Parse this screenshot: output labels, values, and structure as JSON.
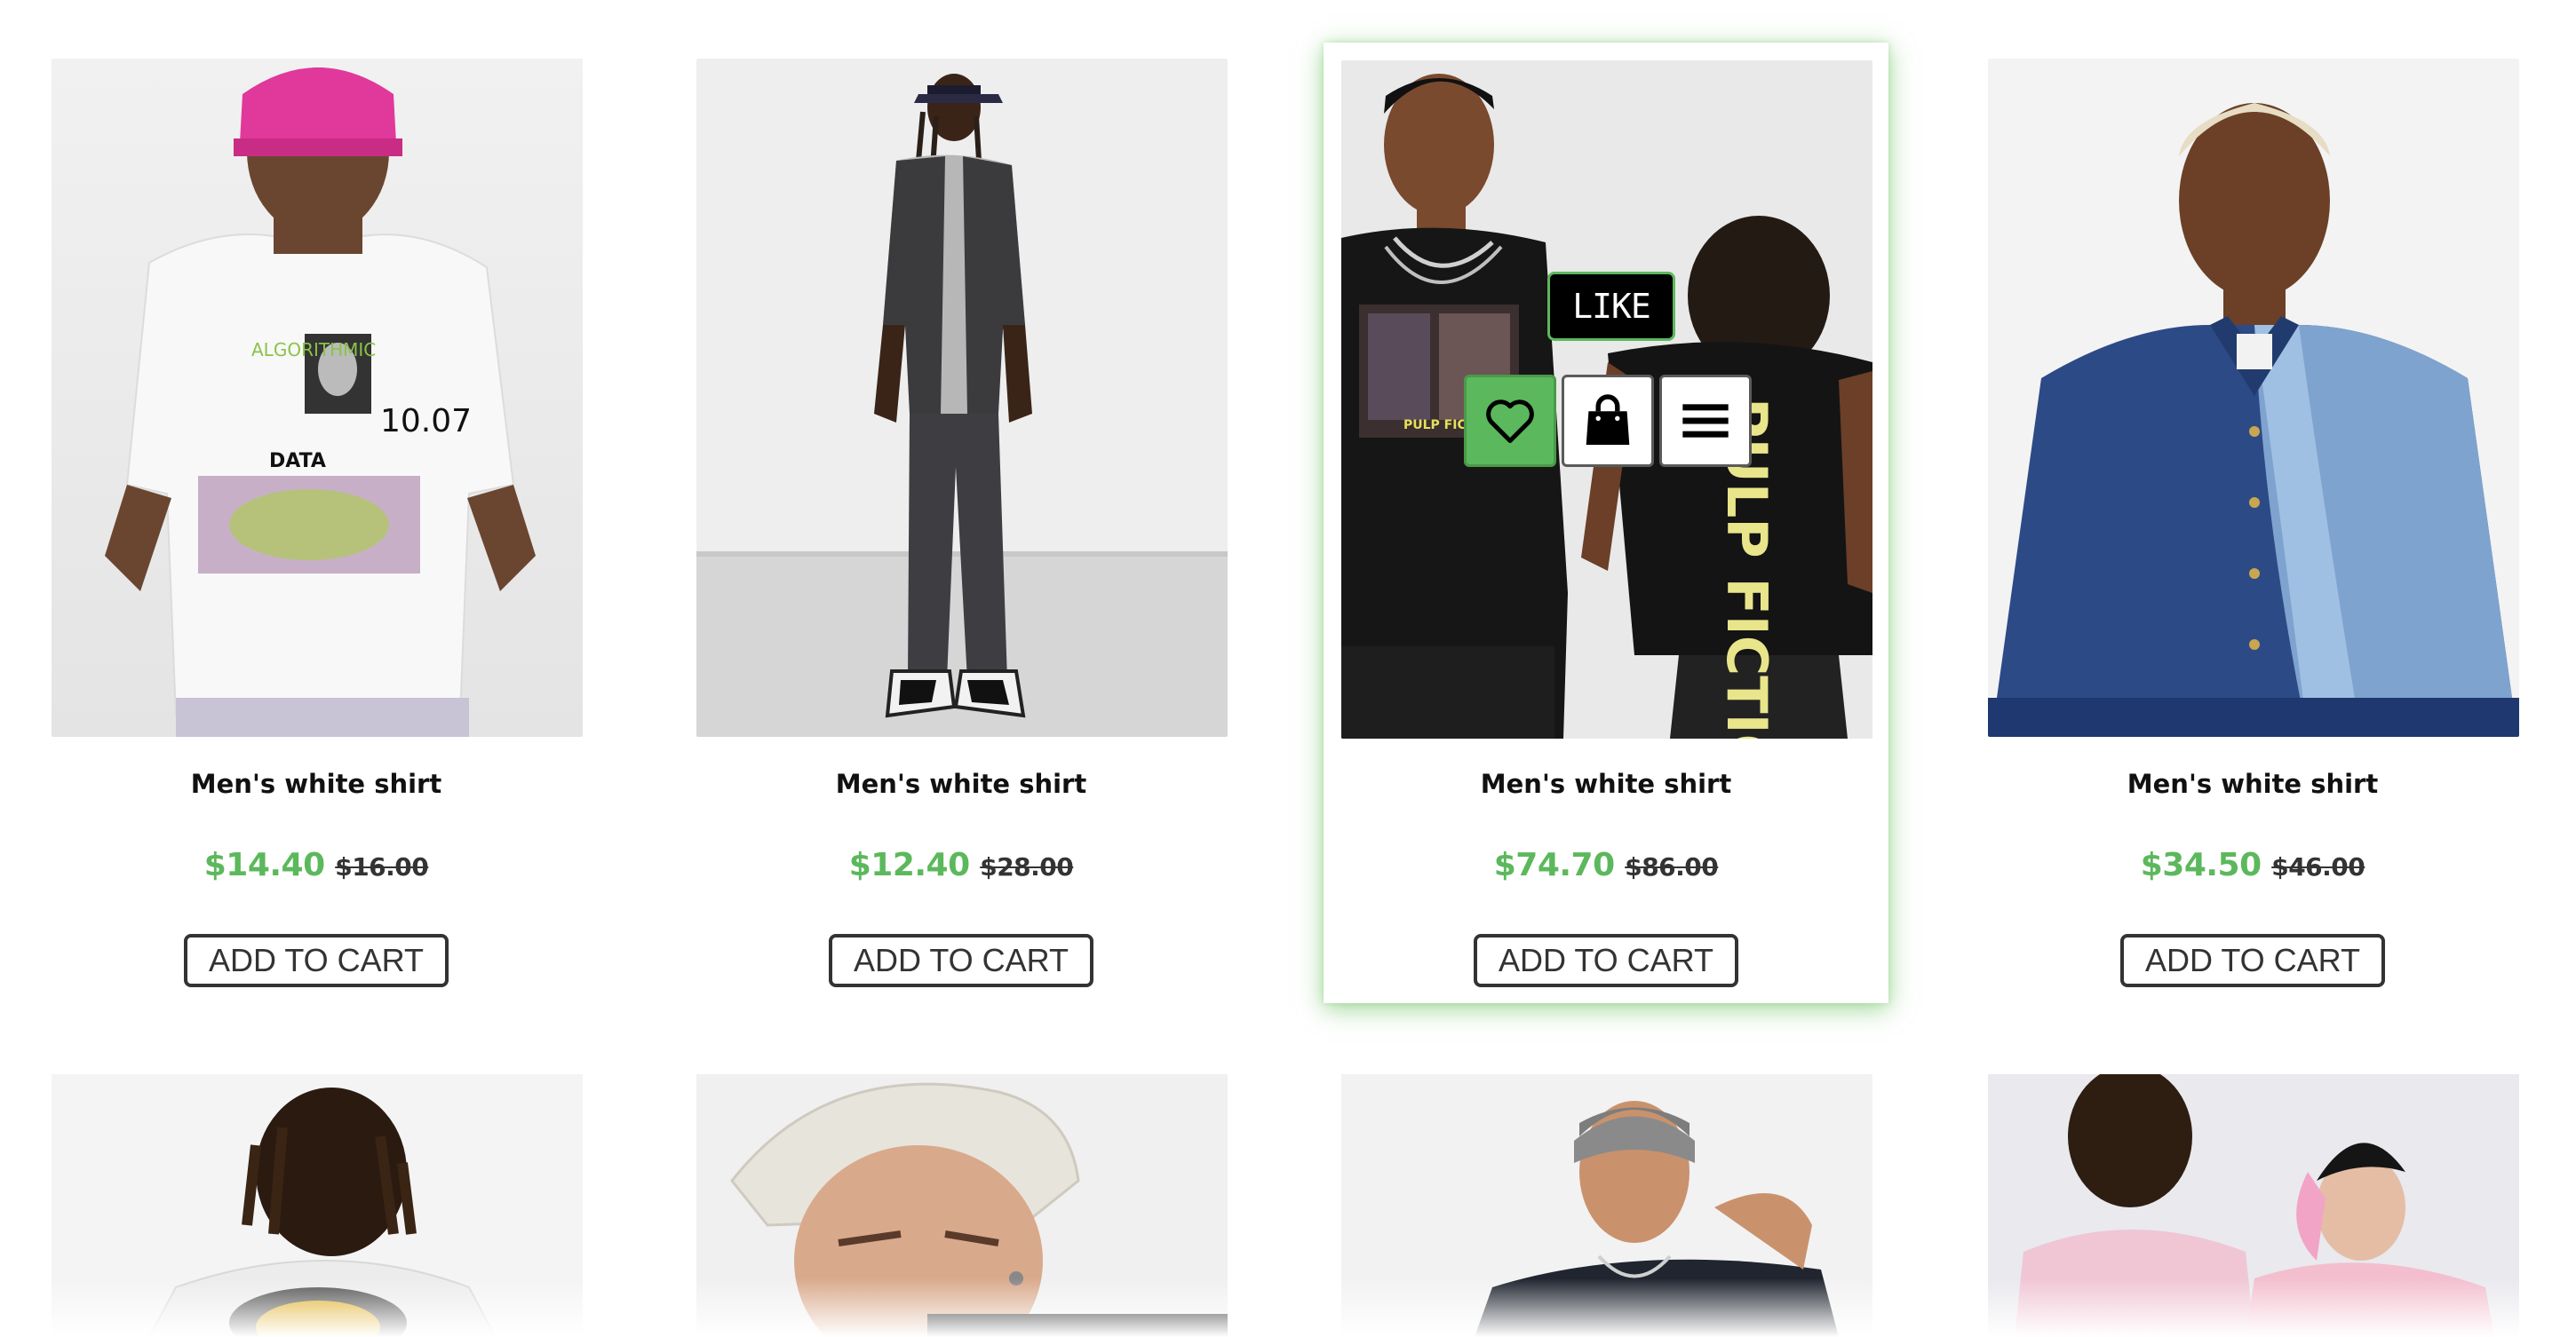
{
  "products_row1": [
    {
      "name": "Men's white shirt",
      "price": "$14.40",
      "old_price": "$16.00",
      "cta": "ADD TO CART",
      "image": "model-white-graphic-tee-pink-beanie"
    },
    {
      "name": "Men's white shirt",
      "price": "$12.40",
      "old_price": "$28.00",
      "cta": "ADD TO CART",
      "image": "model-black-denim-vest-cargo-jeans"
    },
    {
      "name": "Men's white shirt",
      "price": "$74.70",
      "old_price": "$86.00",
      "cta": "ADD TO CART",
      "image": "models-black-pulp-fiction-tees"
    },
    {
      "name": "Men's white shirt",
      "price": "$34.50",
      "old_price": "$46.00",
      "cta": "ADD TO CART",
      "image": "model-blue-colorblock-denim-shirt"
    }
  ],
  "products_row2": [
    {
      "image": "model-back-white-graphic-tee"
    },
    {
      "image": "model-bucket-hat"
    },
    {
      "image": "model-grey-beanie-black-tee"
    },
    {
      "image": "models-pink-tees"
    }
  ],
  "hover_overlay": {
    "tooltip": "LIKE",
    "actions": [
      "heart-icon",
      "shopping-bag-icon",
      "menu-icon"
    ]
  },
  "colors": {
    "accent_green": "#5cb85c",
    "text_dark": "#111111",
    "button_border": "#333333"
  }
}
